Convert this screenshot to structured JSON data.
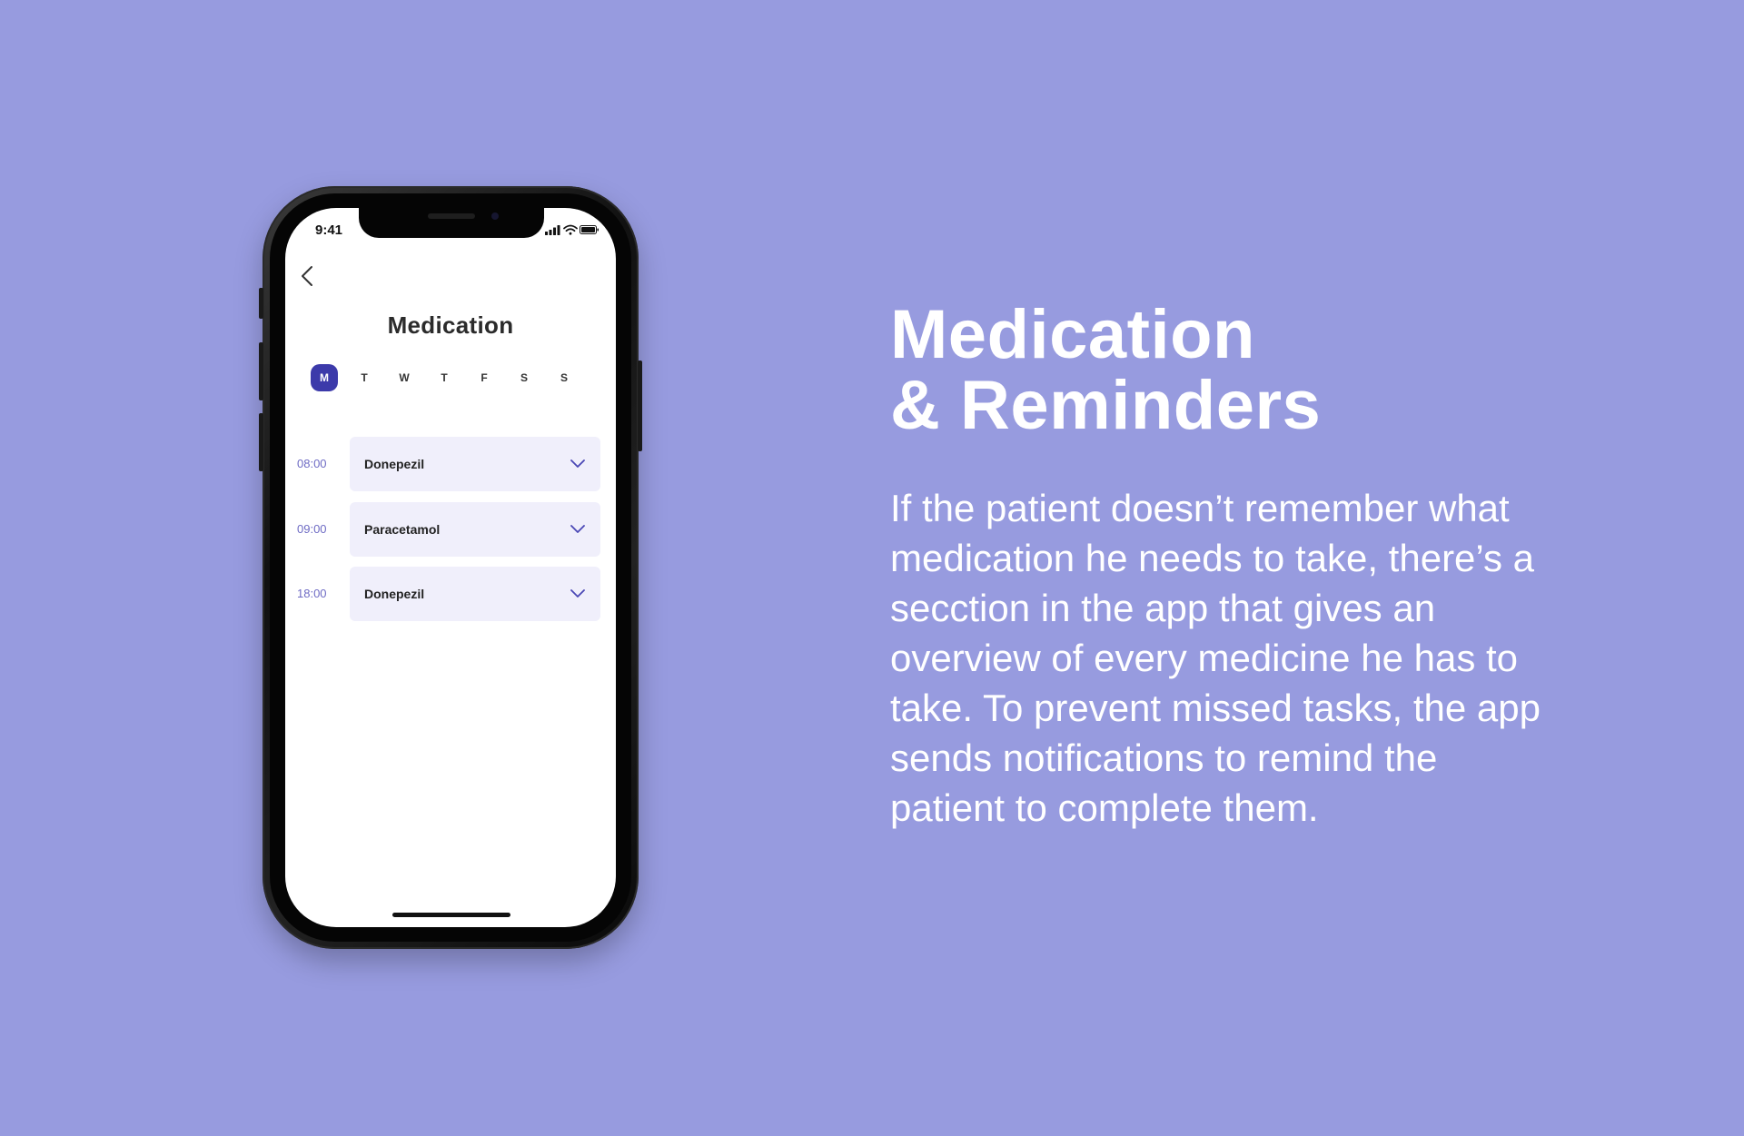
{
  "status_bar": {
    "time": "9:41"
  },
  "screen": {
    "title": "Medication",
    "days": [
      {
        "label": "M",
        "active": true
      },
      {
        "label": "T",
        "active": false
      },
      {
        "label": "W",
        "active": false
      },
      {
        "label": "T",
        "active": false
      },
      {
        "label": "F",
        "active": false
      },
      {
        "label": "S",
        "active": false
      },
      {
        "label": "S",
        "active": false
      }
    ],
    "schedule": [
      {
        "time": "08:00",
        "medicine": "Donepezil"
      },
      {
        "time": "09:00",
        "medicine": "Paracetamol"
      },
      {
        "time": "18:00",
        "medicine": "Donepezil"
      }
    ]
  },
  "headline": {
    "line1": "Medication",
    "line2": "& Reminders"
  },
  "body_text": "If the patient doesn’t remember what\nmedication he needs to take, there’s a\nsecction in the app that gives an\noverview of every medicine he has to\ntake. To prevent missed tasks, the app\nsends notifications to remind the\npatient to complete them.",
  "colors": {
    "background": "#979BDF",
    "accent": "#3C3AAA",
    "card": "#F0EFFB",
    "time_text": "#6E6BC4"
  },
  "icons": {
    "back": "chevron-left-icon",
    "expand": "chevron-down-icon",
    "signal": "cellular-signal-icon",
    "wifi": "wifi-icon",
    "battery": "battery-icon"
  }
}
